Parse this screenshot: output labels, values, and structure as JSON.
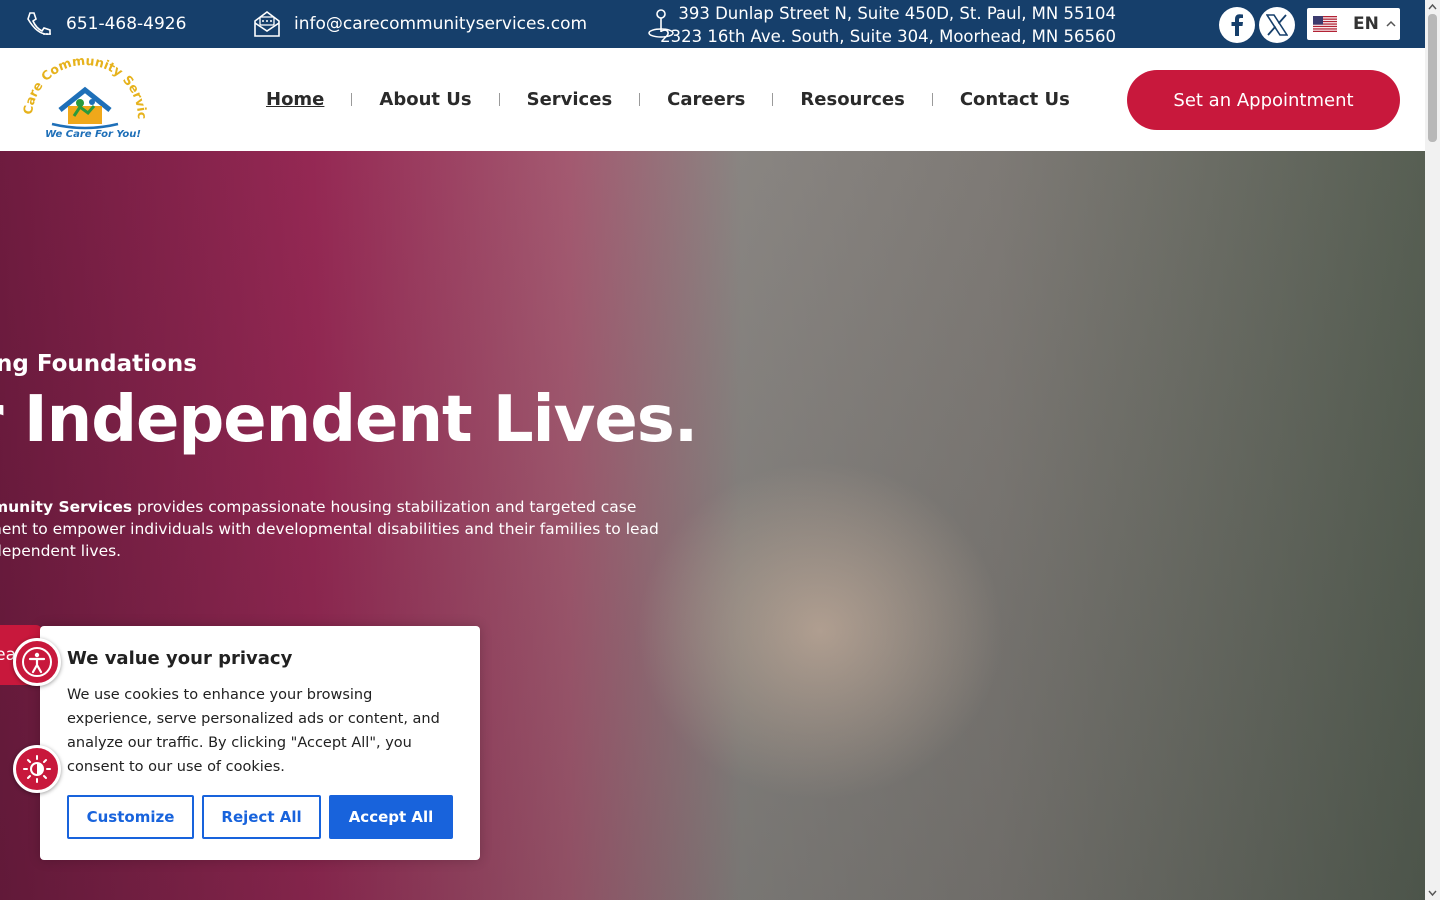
{
  "topbar": {
    "phone": "651-468-4926",
    "email": "info@carecommunityservices.com",
    "address_line1": "393 Dunlap Street N, Suite 450D, St. Paul, MN 55104",
    "address_line2": "2323 16th Ave. South, Suite 304, Moorhead, MN 56560",
    "social": [
      "facebook-icon",
      "x-twitter-icon"
    ],
    "language": "EN"
  },
  "header": {
    "logo_arc_text": "Care Community Services",
    "logo_tagline": "We Care For You!",
    "nav": [
      {
        "label": "Home",
        "active": true
      },
      {
        "label": "About Us",
        "active": false
      },
      {
        "label": "Services",
        "active": false
      },
      {
        "label": "Careers",
        "active": false
      },
      {
        "label": "Resources",
        "active": false
      },
      {
        "label": "Contact Us",
        "active": false
      }
    ],
    "cta_label": "Set an Appointment"
  },
  "hero": {
    "subtitle": "ng Foundations",
    "title": "r Independent Lives.",
    "body_bold": "munity Services",
    "body_line1_rest": " provides compassionate housing stabilization and targeted case",
    "body_line2": "nent to empower individuals with developmental disabilities and their families to lead",
    "body_line3": "dependent lives.",
    "button_fragment": "ea"
  },
  "cookie": {
    "title": "We value your privacy",
    "text": "We use cookies to enhance your browsing experience, serve personalized ads or content, and analyze our traffic. By clicking \"Accept All\", you consent to our use of cookies.",
    "customize": "Customize",
    "reject": "Reject All",
    "accept": "Accept All"
  },
  "colors": {
    "topbar_bg": "#163f6b",
    "brand_red": "#c8183c",
    "cookie_blue": "#1863dc"
  }
}
